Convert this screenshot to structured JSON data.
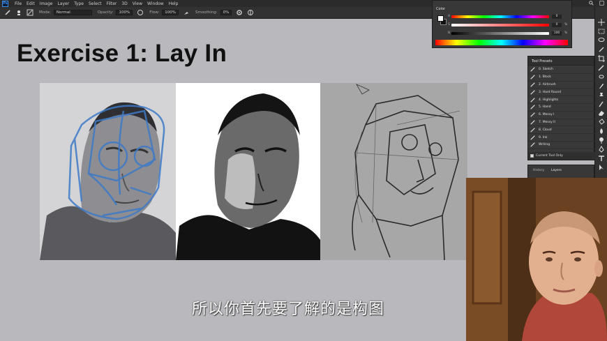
{
  "app": {
    "logo_text": "Ps",
    "menu": [
      "File",
      "Edit",
      "Image",
      "Layer",
      "Type",
      "Select",
      "Filter",
      "3D",
      "View",
      "Window",
      "Help"
    ]
  },
  "options_bar": {
    "mode_label": "Mode:",
    "mode_value": "Normal",
    "opacity_label": "Opacity:",
    "opacity_value": "100%",
    "flow_label": "Flow:",
    "flow_value": "100%",
    "smoothing_label": "Smoothing:",
    "smoothing_value": "0%"
  },
  "canvas": {
    "title": "Exercise 1: Lay In",
    "subtitle": "所以你首先要了解的是构图"
  },
  "color_panel": {
    "tab": "Color",
    "values": [
      "0",
      "0",
      "100"
    ],
    "labels": [
      "H",
      "S",
      "B"
    ],
    "unit": "%"
  },
  "tool_presets": {
    "title": "Tool Presets",
    "items": [
      "0. Sketch",
      "1. Block",
      "2. Airbrush",
      "3. Hard Round",
      "4. Highlights",
      "5. Hand",
      "6. Messy I",
      "7. Messy II",
      "8. Cloud",
      "9. Ink",
      "Writing"
    ],
    "footer": "Current Tool Only"
  },
  "layers_panel": {
    "tabs": [
      "History",
      "Layers"
    ]
  },
  "colors": {
    "canvas_bg": "#b9b8bd",
    "ui_dark": "#2b2b2b",
    "sketch_blue": "#3d7ac7",
    "accent": "#3a8fe8"
  },
  "icons": [
    "brush-icon",
    "zoom-icon",
    "hand-icon",
    "move-icon",
    "marquee-icon",
    "lasso-icon",
    "crop-icon",
    "eyedropper-icon",
    "brush-tool-icon",
    "stamp-icon",
    "eraser-icon",
    "bucket-icon",
    "dodge-icon",
    "pen-icon",
    "type-icon",
    "path-select-icon"
  ]
}
